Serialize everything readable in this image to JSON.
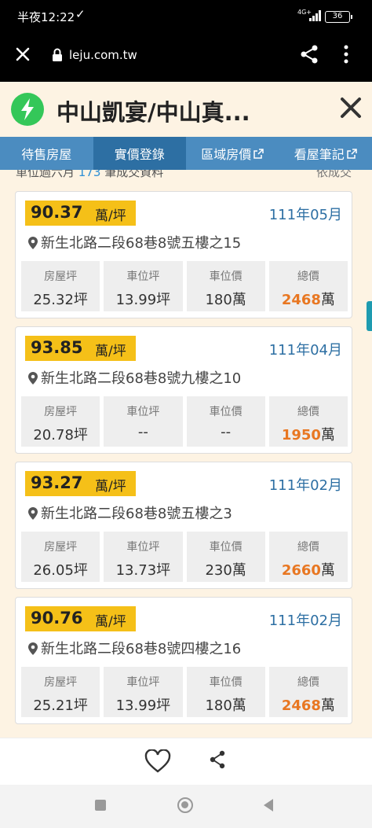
{
  "status": {
    "time": "半夜12:22",
    "check": "✓",
    "network": "4G+",
    "battery": "36"
  },
  "browser": {
    "url": "leju.com.tw"
  },
  "header": {
    "title": "中山凱宴/中山真..."
  },
  "tabs": [
    {
      "label": "待售房屋"
    },
    {
      "label": "實價登錄"
    },
    {
      "label": "區域房價"
    },
    {
      "label": "看屋筆記"
    }
  ],
  "summary": {
    "prefix": "車位過六月",
    "count": "173",
    "suffix": "筆成交資料",
    "right": "依成交"
  },
  "cards": [
    {
      "price": "90.37",
      "unit": "萬/坪",
      "date": "111年05月",
      "address": "新生北路二段68巷8號五樓之15",
      "stats": [
        {
          "label": "房屋坪",
          "value": "25.32坪"
        },
        {
          "label": "車位坪",
          "value": "13.99坪"
        },
        {
          "label": "車位價",
          "value": "180萬"
        },
        {
          "label": "總價",
          "value": "2468",
          "suffix": "萬"
        }
      ]
    },
    {
      "price": "93.85",
      "unit": "萬/坪",
      "date": "111年04月",
      "address": "新生北路二段68巷8號九樓之10",
      "stats": [
        {
          "label": "房屋坪",
          "value": "20.78坪"
        },
        {
          "label": "車位坪",
          "value": "--"
        },
        {
          "label": "車位價",
          "value": "--"
        },
        {
          "label": "總價",
          "value": "1950",
          "suffix": "萬"
        }
      ]
    },
    {
      "price": "93.27",
      "unit": "萬/坪",
      "date": "111年02月",
      "address": "新生北路二段68巷8號五樓之3",
      "stats": [
        {
          "label": "房屋坪",
          "value": "26.05坪"
        },
        {
          "label": "車位坪",
          "value": "13.73坪"
        },
        {
          "label": "車位價",
          "value": "230萬"
        },
        {
          "label": "總價",
          "value": "2660",
          "suffix": "萬"
        }
      ]
    },
    {
      "price": "90.76",
      "unit": "萬/坪",
      "date": "111年02月",
      "address": "新生北路二段68巷8號四樓之16",
      "stats": [
        {
          "label": "房屋坪",
          "value": "25.21坪"
        },
        {
          "label": "車位坪",
          "value": "13.99坪"
        },
        {
          "label": "車位價",
          "value": "180萬"
        },
        {
          "label": "總價",
          "value": "2468",
          "suffix": "萬"
        }
      ]
    }
  ],
  "colors": {
    "accent": "#4b8cc0",
    "tab_active": "#2d6fa3",
    "price_bg": "#f5c018",
    "total_highlight": "#e87722",
    "logo": "#34c759"
  }
}
